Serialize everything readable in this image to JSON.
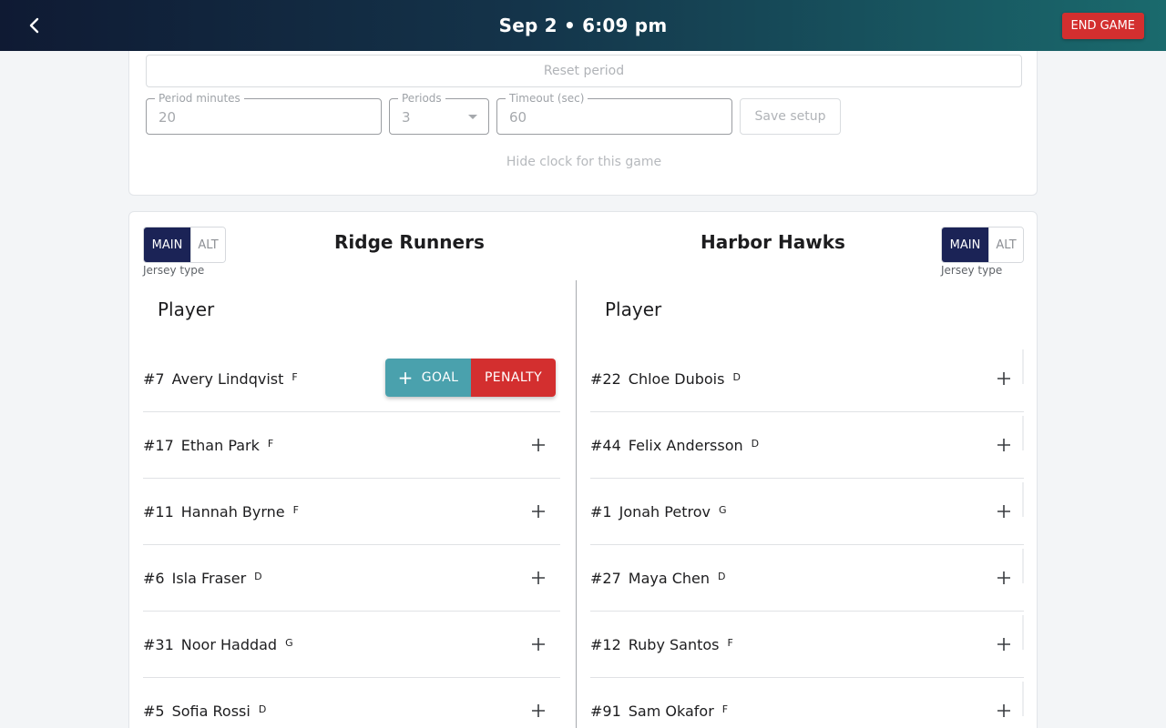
{
  "header": {
    "title": "Sep 2 • 6:09 pm",
    "end_game_label": "END GAME"
  },
  "setup": {
    "reset_label": "Reset period",
    "period_minutes": {
      "label": "Period minutes",
      "value": "20"
    },
    "periods": {
      "label": "Periods",
      "value": "3"
    },
    "timeout": {
      "label": "Timeout (sec)",
      "value": "60"
    },
    "save_label": "Save setup",
    "hide_clock_label": "Hide clock for this game"
  },
  "teams": {
    "jersey_caption": "Jersey type",
    "main_label": "MAIN",
    "alt_label": "ALT",
    "column_header": "Player",
    "goal_label": "GOAL",
    "penalty_label": "PENALTY",
    "home": {
      "name": "Ridge Runners",
      "players": [
        {
          "number": "#7",
          "name": "Avery Lindqvist",
          "pos": "F"
        },
        {
          "number": "#17",
          "name": "Ethan Park",
          "pos": "F"
        },
        {
          "number": "#11",
          "name": "Hannah Byrne",
          "pos": "F"
        },
        {
          "number": "#6",
          "name": "Isla Fraser",
          "pos": "D"
        },
        {
          "number": "#31",
          "name": "Noor Haddad",
          "pos": "G"
        },
        {
          "number": "#5",
          "name": "Sofia Rossi",
          "pos": "D"
        }
      ]
    },
    "away": {
      "name": "Harbor Hawks",
      "players": [
        {
          "number": "#22",
          "name": "Chloe Dubois",
          "pos": "D"
        },
        {
          "number": "#44",
          "name": "Felix Andersson",
          "pos": "D"
        },
        {
          "number": "#1",
          "name": "Jonah Petrov",
          "pos": "G"
        },
        {
          "number": "#27",
          "name": "Maya Chen",
          "pos": "D"
        },
        {
          "number": "#12",
          "name": "Ruby Santos",
          "pos": "F"
        },
        {
          "number": "#91",
          "name": "Sam Okafor",
          "pos": "F"
        }
      ]
    }
  },
  "colors": {
    "accent": "#1b2356",
    "goal": "#4aa1ad",
    "danger": "#d32f2f"
  },
  "icons": {
    "back": "chevron-left-icon",
    "add": "plus-icon",
    "dropdown": "caret-down-icon"
  }
}
